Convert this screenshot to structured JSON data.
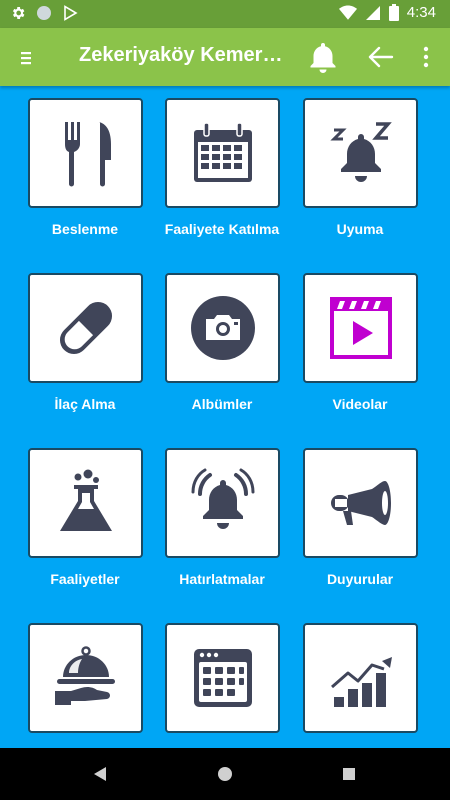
{
  "status_bar": {
    "time": "4:34"
  },
  "app_bar": {
    "title": "Zekeriyaköy Kemerburgaz"
  },
  "tiles": [
    {
      "label": "Beslenme",
      "icon": "fork-knife-icon"
    },
    {
      "label": "Faaliyete Katılma",
      "icon": "calendar-icon"
    },
    {
      "label": "Uyuma",
      "icon": "sleeping-bell-icon"
    },
    {
      "label": "İlaç Alma",
      "icon": "pill-icon"
    },
    {
      "label": "Albümler",
      "icon": "camera-icon"
    },
    {
      "label": "Videolar",
      "icon": "video-icon"
    },
    {
      "label": "Faaliyetler",
      "icon": "flask-icon"
    },
    {
      "label": "Hatırlatmalar",
      "icon": "alarm-bell-icon"
    },
    {
      "label": "Duyurular",
      "icon": "megaphone-icon"
    },
    {
      "label": "",
      "icon": "food-tray-icon"
    },
    {
      "label": "",
      "icon": "calendar-grid-icon"
    },
    {
      "label": "",
      "icon": "growth-chart-icon"
    }
  ],
  "colors": {
    "background": "#00a6f5",
    "app_bar": "#8bc34a",
    "status_bar": "#689f38",
    "icon": "#404559",
    "video_accent": "#c000d0"
  }
}
